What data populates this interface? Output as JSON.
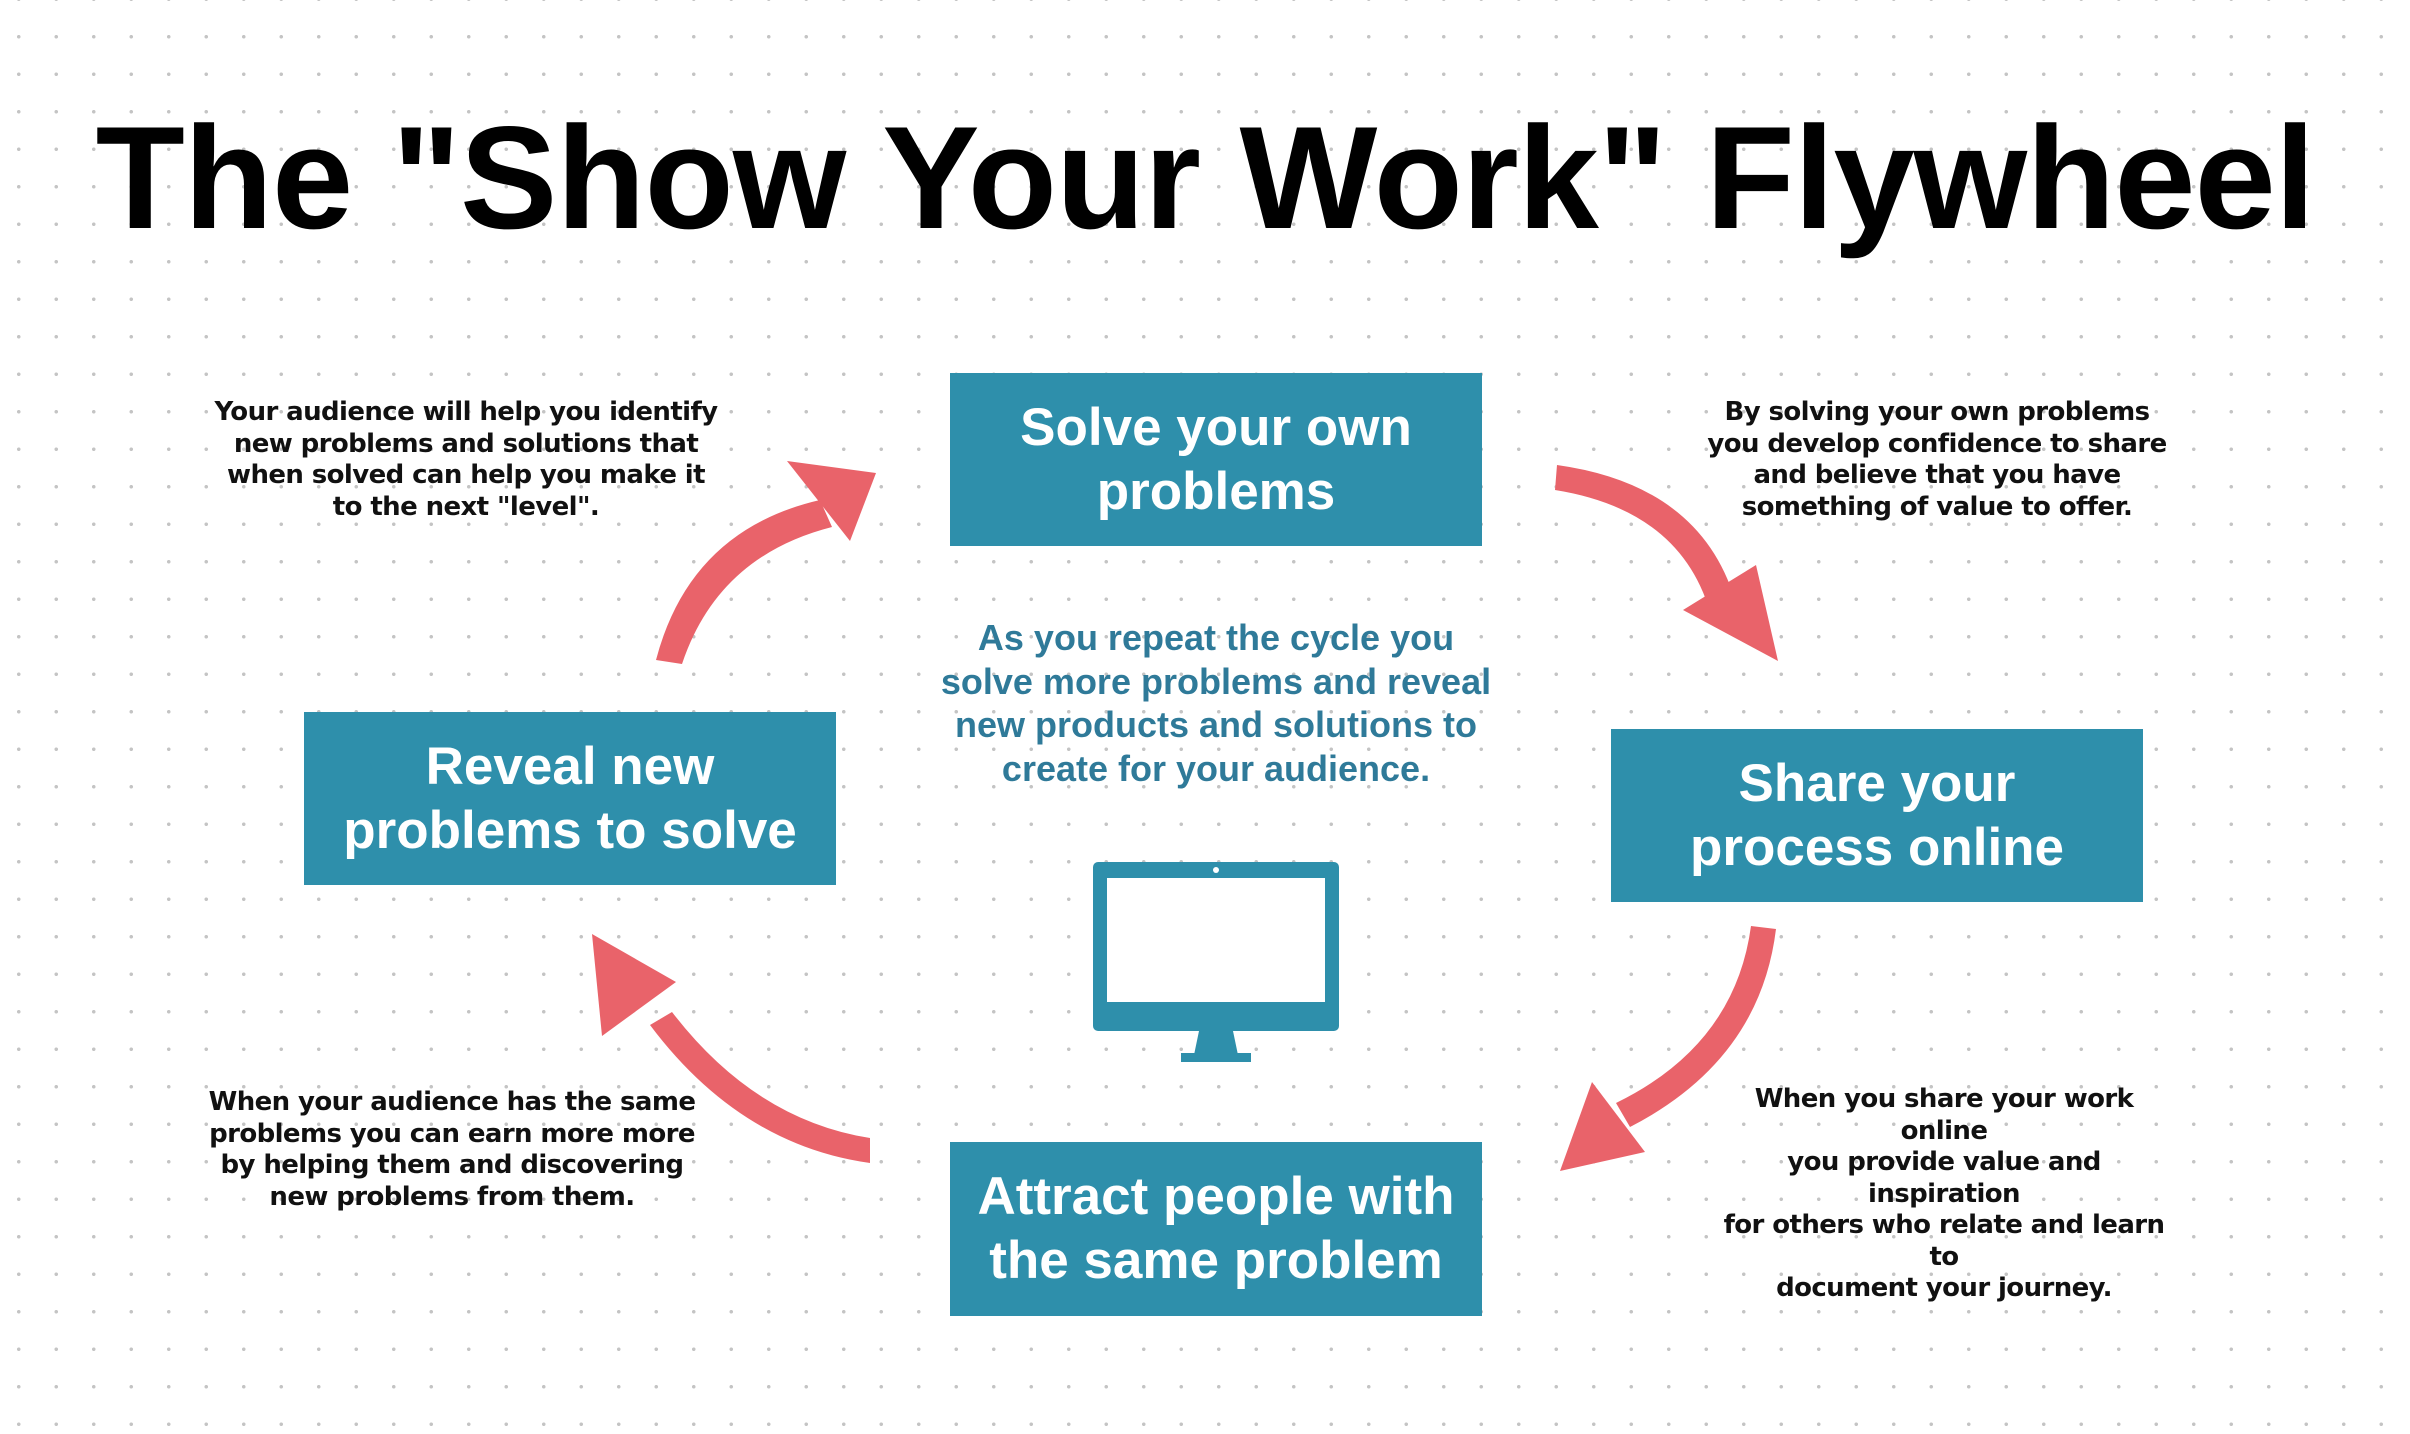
{
  "title": "The \"Show Your Work\" Flywheel",
  "colors": {
    "box_fill": "#2E8FAB",
    "arrow": "#E9636A",
    "center_text": "#2F7A99",
    "text": "#111111"
  },
  "steps": [
    {
      "id": "solve",
      "label": "Solve your own\nproblems"
    },
    {
      "id": "share",
      "label": "Share your\nprocess online"
    },
    {
      "id": "attract",
      "label": "Attract people with\nthe same problem"
    },
    {
      "id": "reveal",
      "label": "Reveal new\nproblems to solve"
    }
  ],
  "notes": {
    "top_left": "Your audience will help you identify\nnew problems and solutions that\nwhen solved can help you make it\nto the next \"level\".",
    "top_right": "By solving your own problems\nyou develop confidence to share\nand believe that you have\nsomething of value to offer.",
    "bottom_right": "When you share your work online\nyou provide value and inspiration\nfor others who relate and learn to\ndocument your journey.",
    "bottom_left": "When your audience has the same\nproblems you can earn more more\nby helping them and discovering\nnew problems from them."
  },
  "center_text": "As you repeat the cycle you\nsolve more problems and reveal\nnew products and solutions to\ncreate for your audience.",
  "icons": {
    "center": "monitor-icon",
    "arrows": [
      "arrow-solve-to-share",
      "arrow-share-to-attract",
      "arrow-attract-to-reveal",
      "arrow-reveal-to-solve"
    ]
  }
}
